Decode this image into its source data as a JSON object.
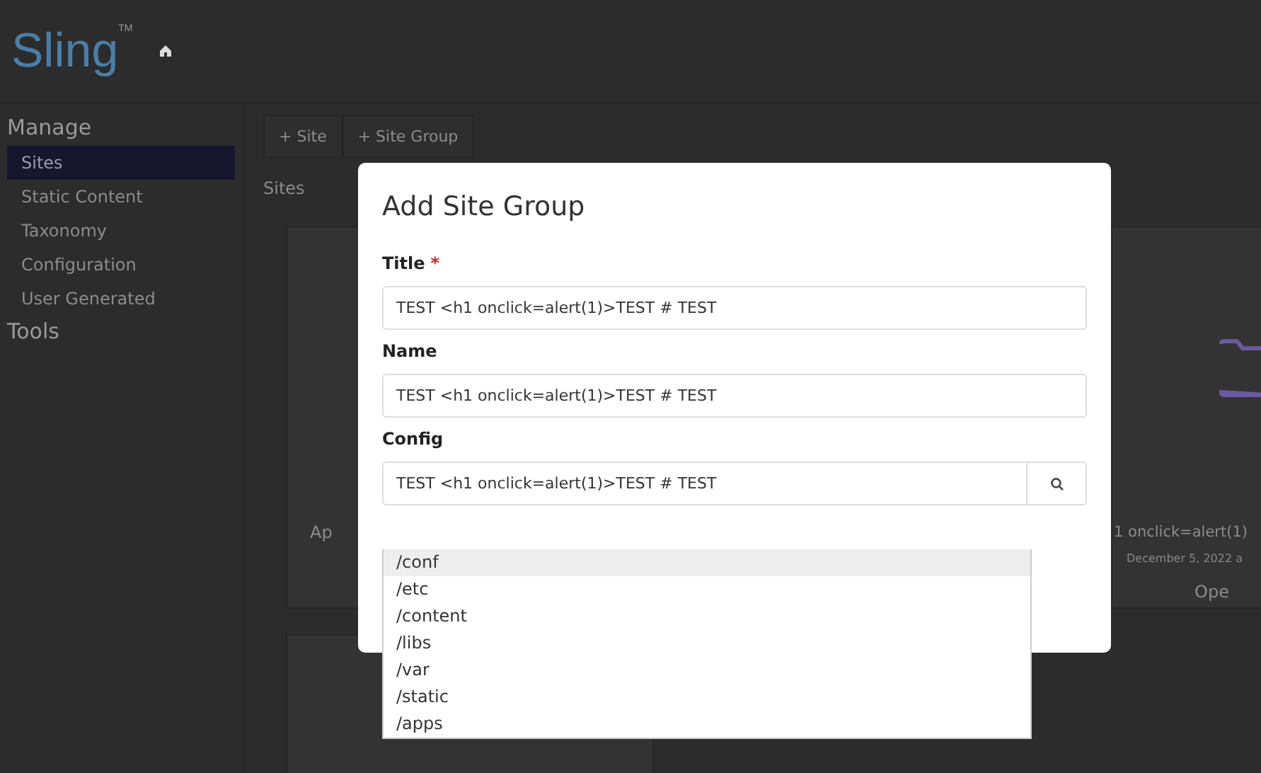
{
  "header": {
    "logo": "Sling",
    "logo_mark": "TM"
  },
  "sidebar": {
    "sections": [
      {
        "title": "Manage",
        "items": [
          {
            "label": "Sites",
            "selected": true
          },
          {
            "label": "Static Content",
            "selected": false
          },
          {
            "label": "Taxonomy",
            "selected": false
          },
          {
            "label": "Configuration",
            "selected": false
          },
          {
            "label": "User Generated",
            "selected": false
          }
        ]
      },
      {
        "title": "Tools"
      }
    ]
  },
  "toolbar": {
    "buttons": [
      "+ Site",
      "+ Site Group"
    ]
  },
  "breadcrumb": "Sites",
  "cards": [
    {
      "title": "Ap"
    },
    {
      "title": "1 onclick=alert(1)",
      "date": "December 5, 2022 a",
      "action": "Ope"
    }
  ],
  "dialog": {
    "title": "Add Site Group",
    "fields": [
      {
        "label": "Title",
        "required_mark": "*",
        "value": "TEST <h1 onclick=alert(1)>TEST # TEST"
      },
      {
        "label": "Name",
        "value": "TEST <h1 onclick=alert(1)>TEST # TEST"
      },
      {
        "label": "Config",
        "value": "TEST <h1 onclick=alert(1)>TEST # TEST",
        "kind": "search"
      }
    ],
    "options": [
      {
        "label": "/conf",
        "selected": true
      },
      {
        "label": "/etc",
        "selected": false
      },
      {
        "label": "/content",
        "selected": false
      },
      {
        "label": "/libs",
        "selected": false
      },
      {
        "label": "/var",
        "selected": false
      },
      {
        "label": "/static",
        "selected": false
      },
      {
        "label": "/apps",
        "selected": false
      }
    ]
  }
}
